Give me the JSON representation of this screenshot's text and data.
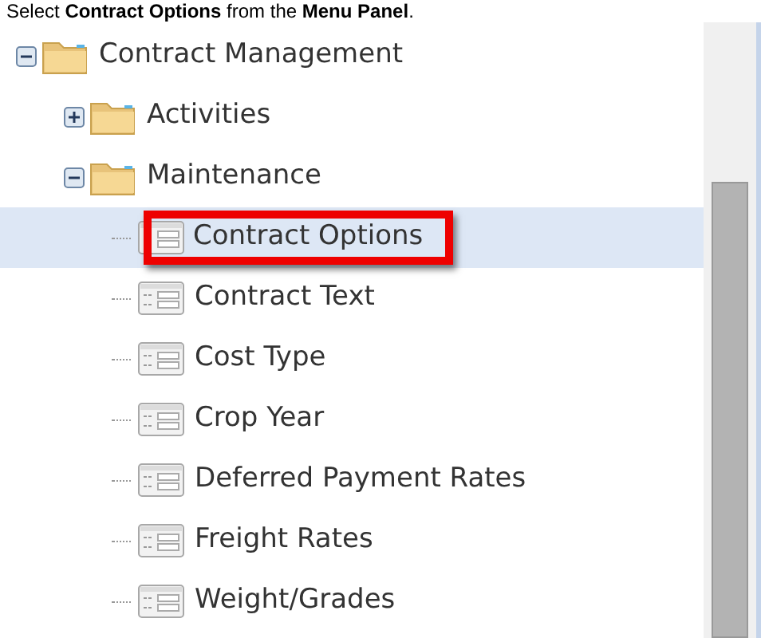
{
  "instruction": "Select **Contract Options** from the **Menu Panel**.",
  "tree": [
    {
      "label": "Contract Management",
      "kind": "folder",
      "expanded": true,
      "children": [
        {
          "label": "Activities",
          "kind": "folder",
          "expanded": false
        },
        {
          "label": "Maintenance",
          "kind": "folder",
          "expanded": true,
          "children": [
            {
              "label": "Contract Options",
              "kind": "form",
              "selected": true,
              "callout": true
            },
            {
              "label": "Contract Text",
              "kind": "form",
              "selected": false,
              "callout": false
            },
            {
              "label": "Cost Type",
              "kind": "form",
              "selected": false,
              "callout": false
            },
            {
              "label": "Crop Year",
              "kind": "form",
              "selected": false,
              "callout": false
            },
            {
              "label": "Deferred Payment Rates",
              "kind": "form",
              "selected": false,
              "callout": false
            },
            {
              "label": "Freight Rates",
              "kind": "form",
              "selected": false,
              "callout": false
            },
            {
              "label": "Weight/Grades",
              "kind": "form",
              "selected": false,
              "callout": false
            }
          ]
        }
      ]
    }
  ]
}
